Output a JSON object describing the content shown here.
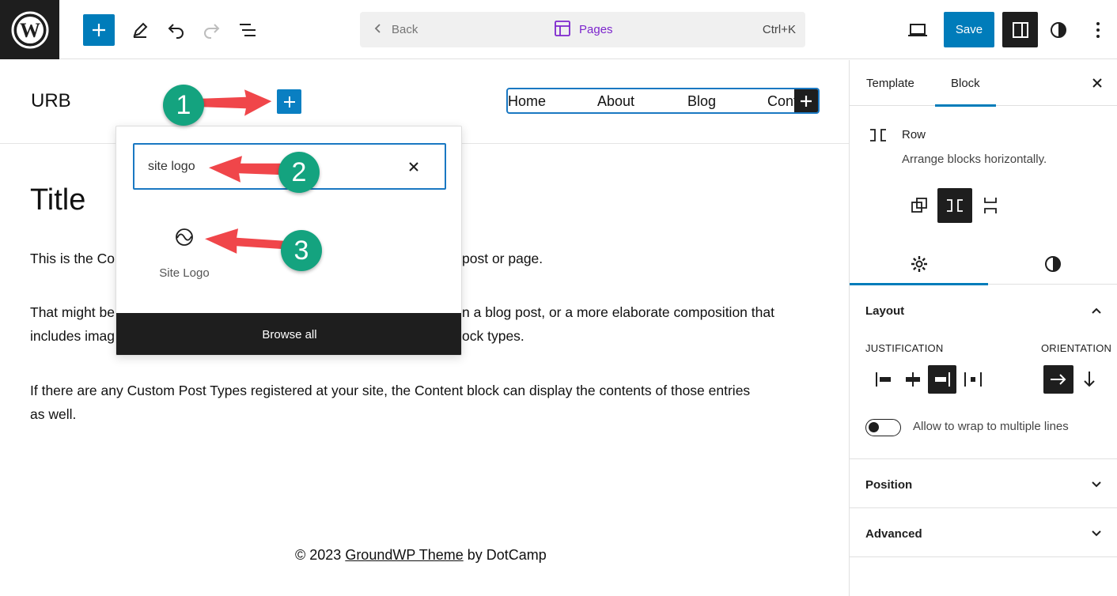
{
  "toolbar": {
    "inserter_label": "+",
    "back_label": "Back",
    "command_center_label": "Pages",
    "command_shortcut": "Ctrl+K",
    "save_label": "Save"
  },
  "canvas": {
    "site_title": "URB",
    "nav_items": [
      "Home",
      "About",
      "Blog",
      "Cont"
    ],
    "page_title": "Title",
    "para1": "This is the Co",
    "para1_end": "post or page.",
    "para2_line1_start": "That might be",
    "para2_line1_end": "n a blog post, or a more elaborate composition that",
    "para2_line2_start": "includes imag",
    "para2_line2_end": "ock types.",
    "para3_line1": "If there are any Custom Post Types registered at your site, the Content block can display the contents of those entries",
    "para3_line2": "as well.",
    "footer_prefix": "© 2023 ",
    "footer_link": "GroundWP Theme",
    "footer_suffix": " by DotCamp"
  },
  "inserter_popover": {
    "search_value": "site logo",
    "result_label": "Site Logo",
    "result_icon": "site-logo-icon",
    "browse_all_label": "Browse all"
  },
  "annotations": {
    "badges": [
      "1",
      "2",
      "3"
    ],
    "arrow_color": "#f0464a",
    "badge_color": "#14a37f"
  },
  "sidebar": {
    "tabs": [
      "Template",
      "Block"
    ],
    "active_tab": "Block",
    "block_name": "Row",
    "block_description": "Arrange blocks horizontally.",
    "panels": {
      "layout": {
        "title": "Layout",
        "justification_label": "JUSTIFICATION",
        "orientation_label": "ORIENTATION",
        "active_justification": "right",
        "active_orientation": "horizontal",
        "wrap_label": "Allow to wrap to multiple lines",
        "wrap_enabled": false
      },
      "position": {
        "title": "Position"
      },
      "advanced": {
        "title": "Advanced"
      }
    }
  },
  "colors": {
    "accent": "#007cba",
    "dark": "#1e1e1e",
    "command_center_text": "#7d26cd"
  }
}
